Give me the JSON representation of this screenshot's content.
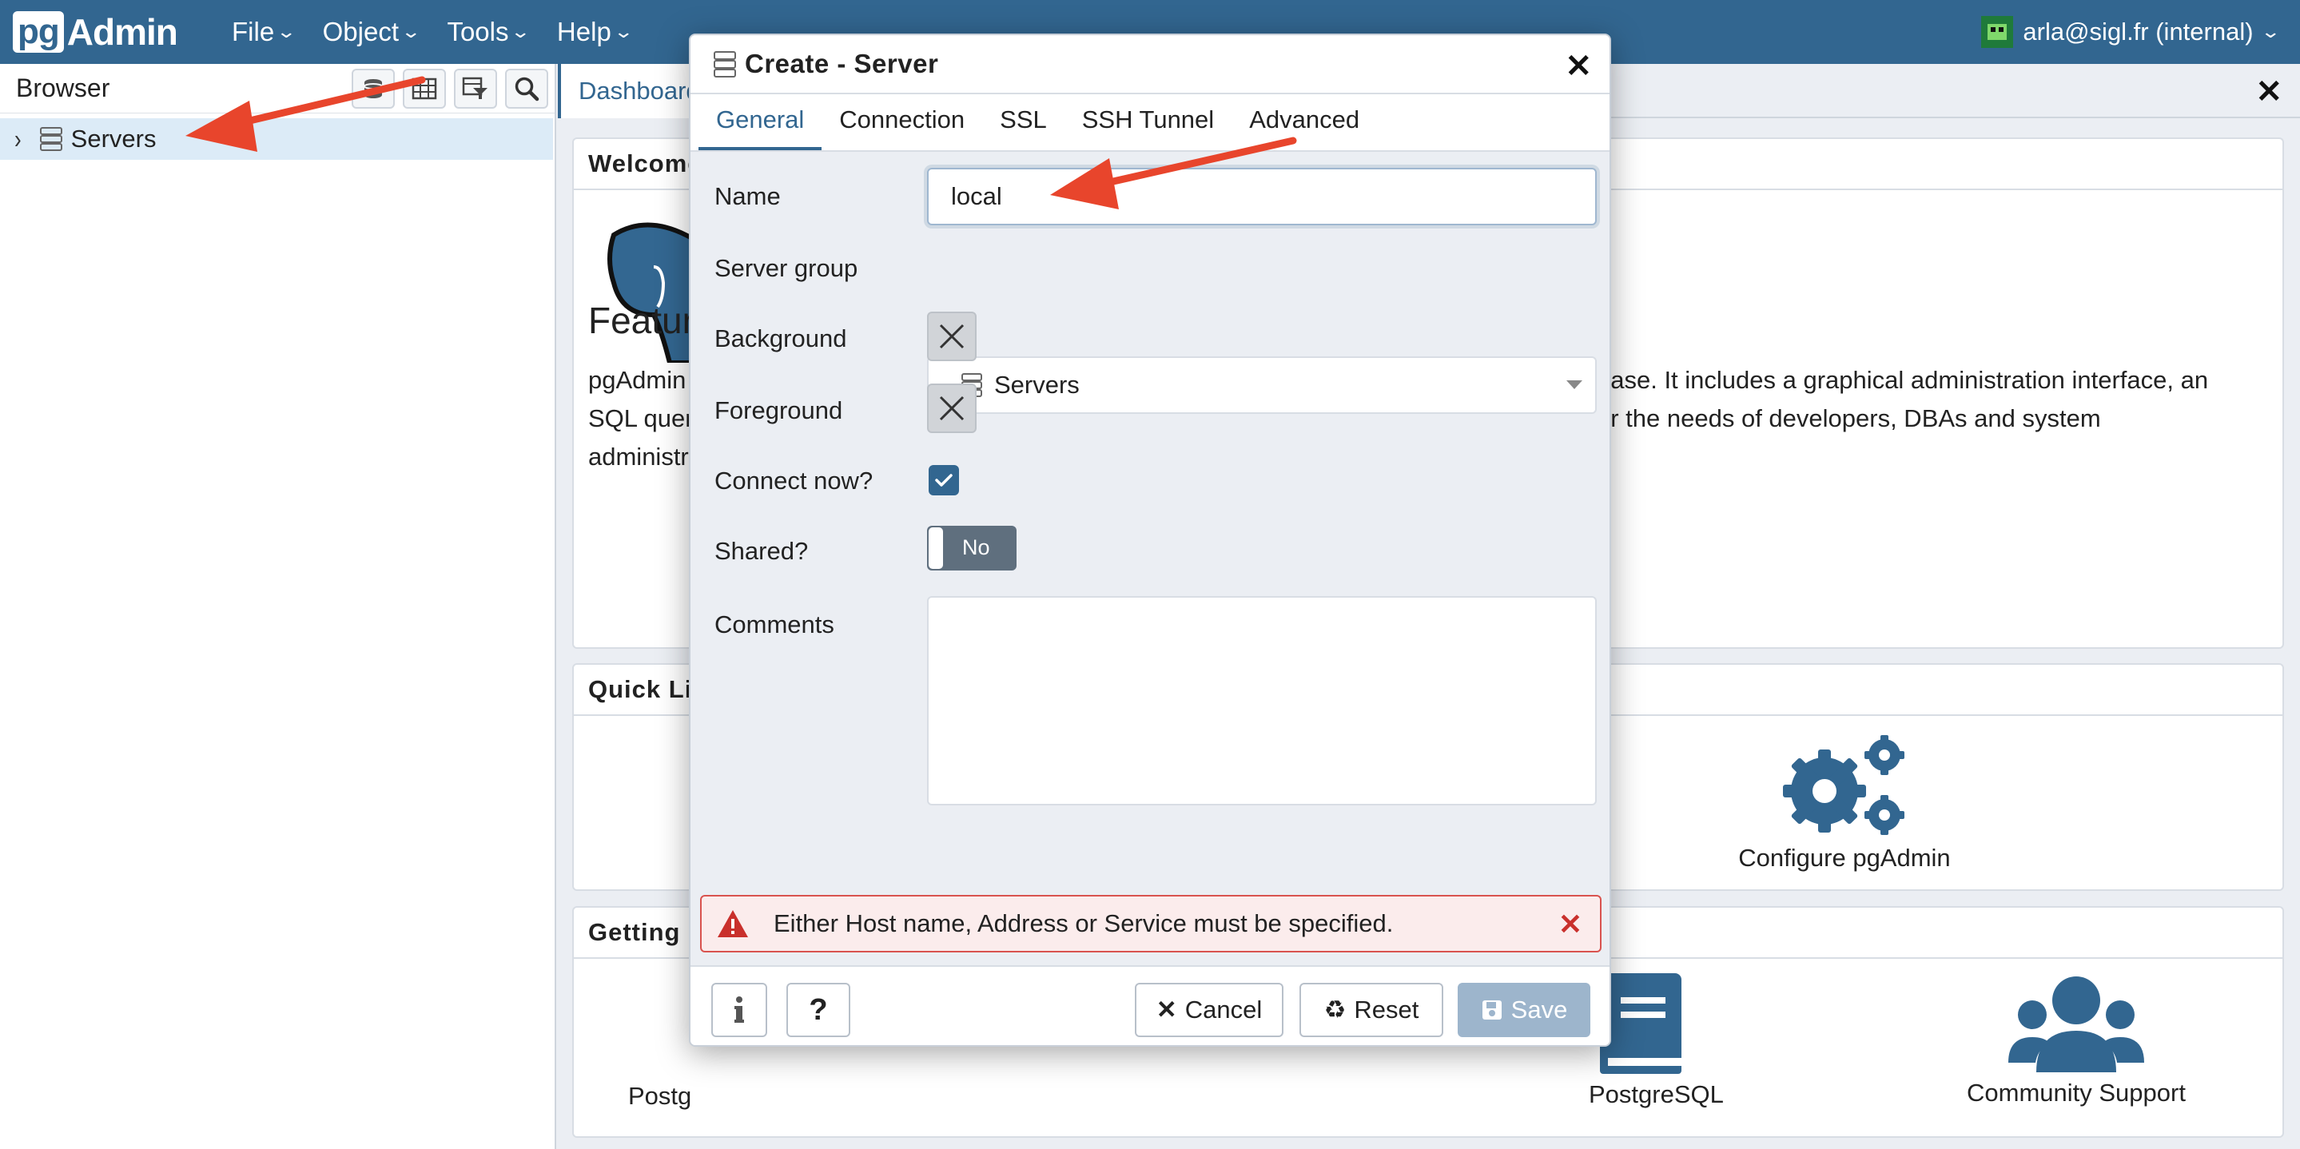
{
  "navbar": {
    "logo_pg": "pg",
    "logo_admin": "Admin",
    "menu": [
      {
        "label": "File"
      },
      {
        "label": "Object"
      },
      {
        "label": "Tools"
      },
      {
        "label": "Help"
      }
    ],
    "user": "arla@sigl.fr (internal)"
  },
  "browser": {
    "title": "Browser",
    "tree": [
      {
        "label": "Servers"
      }
    ]
  },
  "main": {
    "tab": "Dashboard",
    "welcome": {
      "header": "Welcome",
      "feature_title": "Feature",
      "text_line1_left": "pgAdmin",
      "text_line2_left": "SQL quer",
      "text_line3_left": "administr",
      "text_line1_right": "base. It includes a graphical administration interface, an",
      "text_line2_right": "er the needs of developers, DBAs and system"
    },
    "quick_links": {
      "header": "Quick Li",
      "configure_label": "Configure pgAdmin"
    },
    "getting_started": {
      "header": "Getting",
      "postgres_left": "Postg",
      "postgresql_label": "PostgreSQL",
      "community_label": "Community Support"
    }
  },
  "dialog": {
    "title": "Create - Server",
    "tabs": [
      {
        "label": "General",
        "active": true
      },
      {
        "label": "Connection",
        "active": false
      },
      {
        "label": "SSL",
        "active": false
      },
      {
        "label": "SSH Tunnel",
        "active": false
      },
      {
        "label": "Advanced",
        "active": false
      }
    ],
    "fields": {
      "name_label": "Name",
      "name_value": "local",
      "server_group_label": "Server group",
      "server_group_value": "Servers",
      "background_label": "Background",
      "foreground_label": "Foreground",
      "connect_now_label": "Connect now?",
      "connect_now_checked": true,
      "shared_label": "Shared?",
      "shared_value": "No",
      "comments_label": "Comments",
      "comments_value": ""
    },
    "error": "Either Host name, Address or Service must be specified.",
    "footer": {
      "cancel": "Cancel",
      "reset": "Reset",
      "save": "Save"
    }
  },
  "colors": {
    "brand": "#326690",
    "arrow": "#e8452c",
    "error": "#d9534f"
  }
}
